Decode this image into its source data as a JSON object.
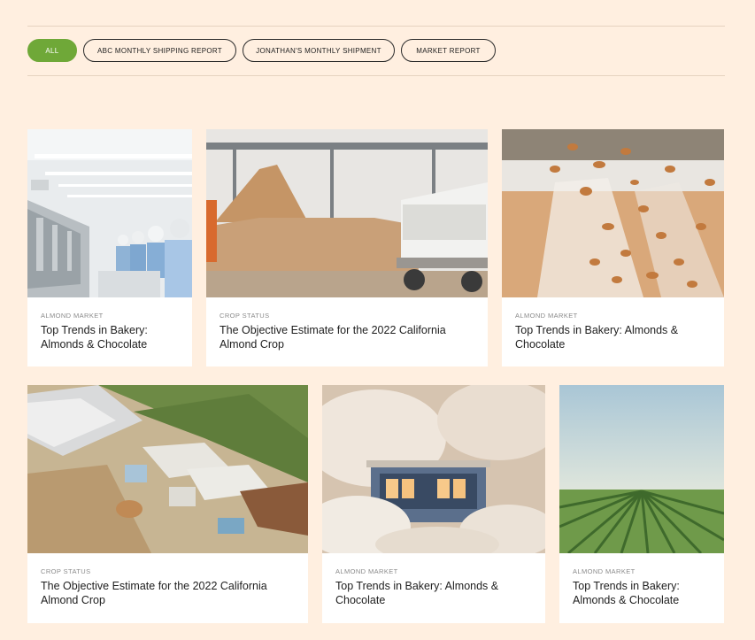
{
  "filters": {
    "all": "ALL",
    "abc": "ABC MONTHLY SHIPPING REPORT",
    "jonathan": "JONATHAN'S MONTHLY SHIPMENT",
    "market": "MARKET REPORT"
  },
  "colors": {
    "accent": "#6fa838",
    "background": "#FFEFE0"
  },
  "cards": [
    {
      "image": "processing-line-workers-photo",
      "category": "ALMOND MARKET",
      "title": "Top Trends in Bakery: Almonds & Chocolate"
    },
    {
      "image": "almond-stockpile-truck-photo",
      "category": "CROP STATUS",
      "title": "The Objective Estimate for the 2022 California Almond Crop"
    },
    {
      "image": "falling-almonds-photo",
      "category": "ALMOND MARKET",
      "title": "Top Trends in Bakery: Almonds & Chocolate"
    },
    {
      "image": "aerial-facility-photo",
      "category": "CROP STATUS",
      "title": "The Objective Estimate for the 2022 California Almond Crop"
    },
    {
      "image": "harvester-dust-photo",
      "category": "ALMOND MARKET",
      "title": "Top Trends in Bakery: Almonds & Chocolate"
    },
    {
      "image": "orchard-rows-photo",
      "category": "ALMOND MARKET",
      "title": "Top Trends in Bakery: Almonds & Chocolate"
    }
  ]
}
